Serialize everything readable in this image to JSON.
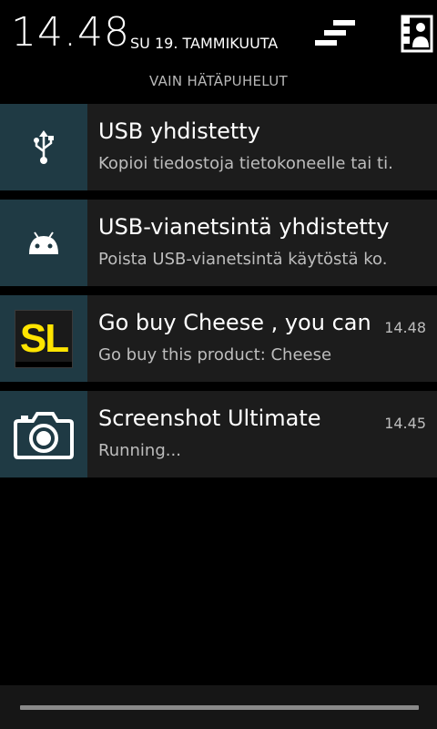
{
  "header": {
    "time": "14.48",
    "date": "SU 19. TAMMIKUUTA",
    "clear_icon": "clear-all-icon",
    "settings_icon": "quick-settings-icon",
    "emergency_text": "VAIN HÄTÄPUHELUT"
  },
  "notifications": [
    {
      "icon": "usb-icon",
      "title": "USB yhdistetty",
      "text": "Kopioi tiedostoja tietokoneelle tai ti.",
      "time": ""
    },
    {
      "icon": "android-debug-icon",
      "title": "USB-vianetsintä yhdistetty",
      "text": "Poista USB-vianetsintä käytöstä ko.",
      "time": ""
    },
    {
      "icon": "sl-app-icon",
      "icon_text": "SL",
      "title": "Go buy Cheese , you can.",
      "text": "Go buy this product: Cheese",
      "time": "14.48"
    },
    {
      "icon": "camera-icon",
      "title": "Screenshot Ultimate",
      "text": "Running...",
      "time": "14.45"
    }
  ],
  "colors": {
    "background": "#000000",
    "card": "#1c1c1c",
    "icon_box": "#1f3a44",
    "sl_yellow": "#ffe400"
  }
}
